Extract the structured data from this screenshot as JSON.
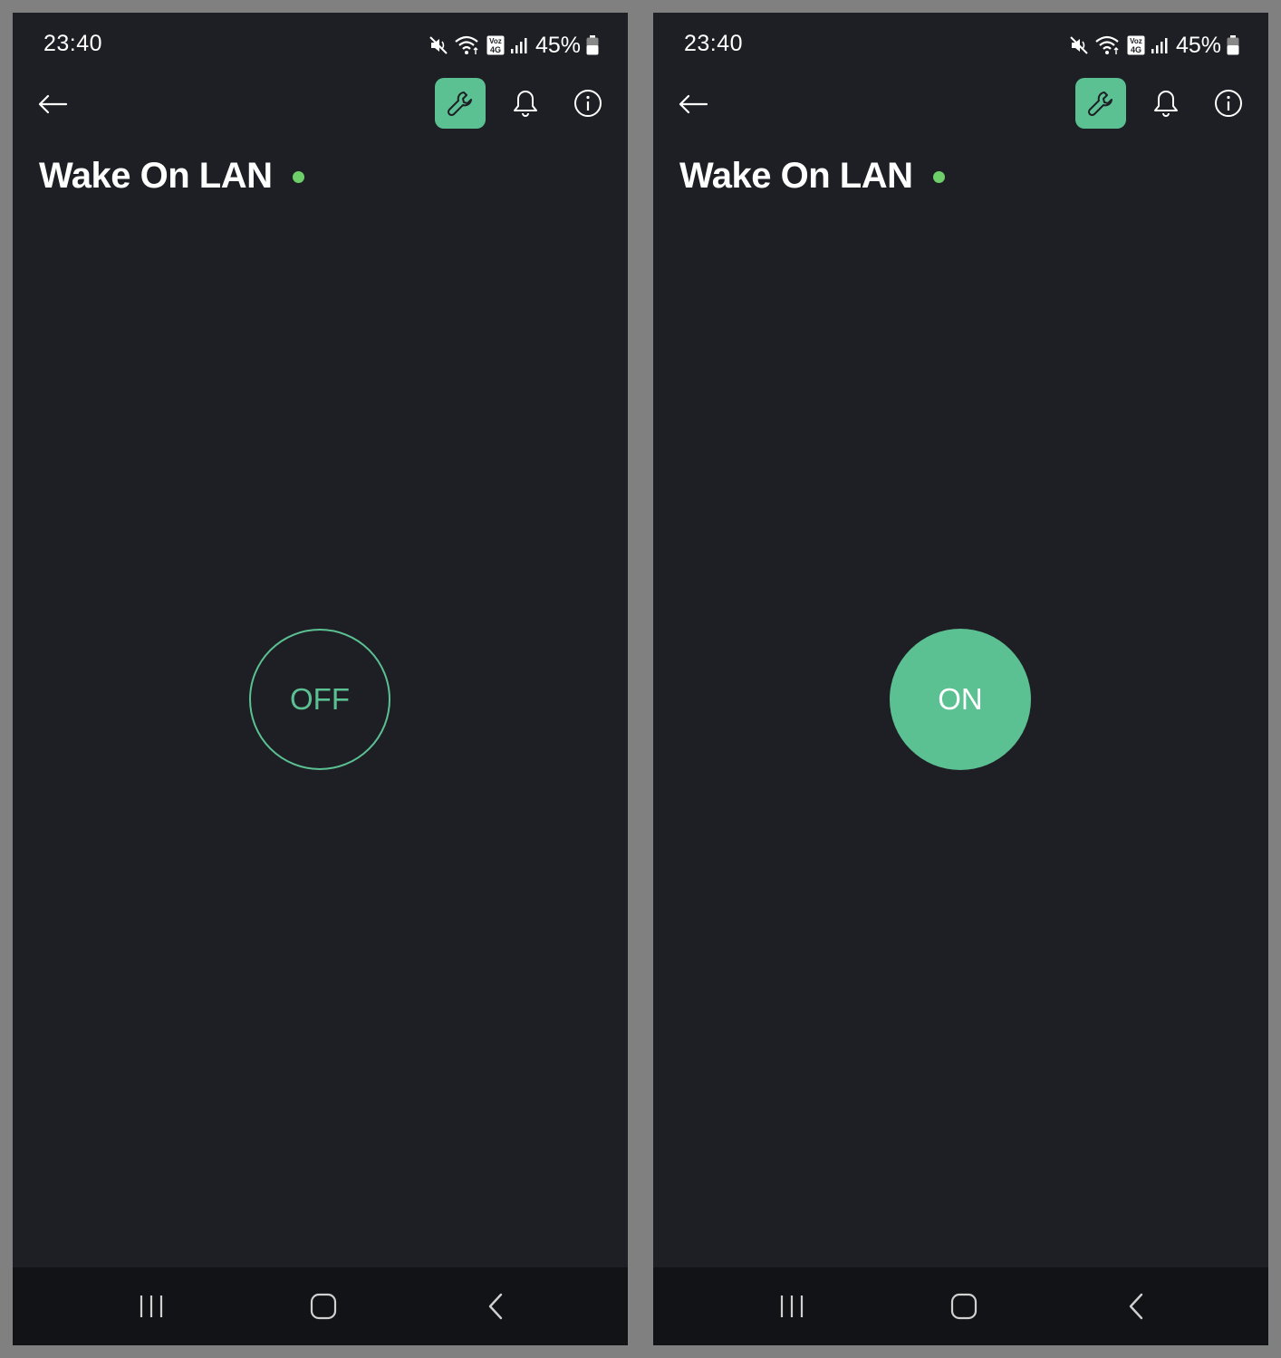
{
  "colors": {
    "accent": "#5bc193",
    "online_dot": "#6ecf6a",
    "background": "#1e1f24",
    "nav_bar": "#121316",
    "frame": "#808080",
    "text": "#ffffff"
  },
  "icons": {
    "status": [
      "mute-icon",
      "wifi-icon",
      "volte-4g-icon",
      "signal-icon",
      "battery-icon"
    ],
    "app_bar": [
      "back-arrow-icon",
      "wrench-icon",
      "bell-icon",
      "info-icon"
    ],
    "nav": [
      "recents-icon",
      "home-icon",
      "back-chevron-icon"
    ]
  },
  "screens": [
    {
      "status_bar": {
        "time": "23:40",
        "battery": "45%",
        "network_badge_top": "Voz",
        "network_badge_bottom": "4G"
      },
      "title": "Wake On LAN",
      "device_online": true,
      "power_button": {
        "label": "OFF",
        "state": "off"
      }
    },
    {
      "status_bar": {
        "time": "23:40",
        "battery": "45%",
        "network_badge_top": "Voz",
        "network_badge_bottom": "4G"
      },
      "title": "Wake On LAN",
      "device_online": true,
      "power_button": {
        "label": "ON",
        "state": "on"
      }
    }
  ]
}
